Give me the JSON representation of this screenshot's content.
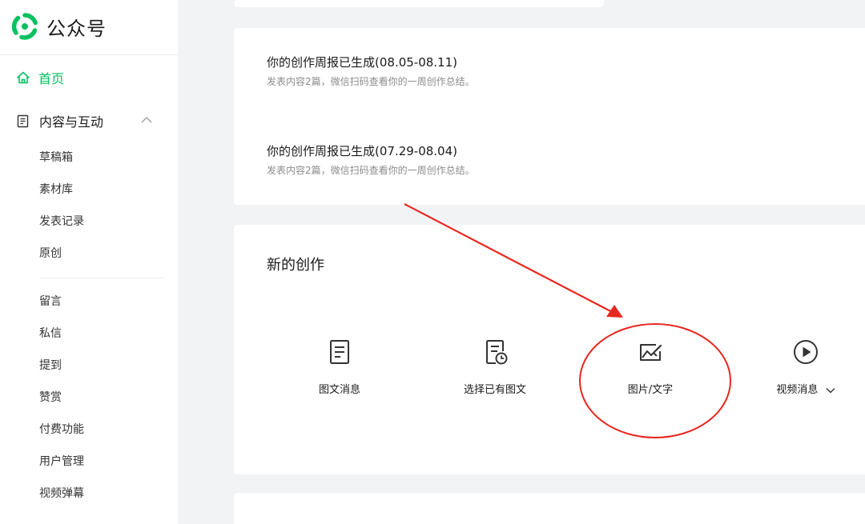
{
  "brand": {
    "name": "公众号",
    "accent": "#07c160"
  },
  "sidebar": {
    "home_label": "首页",
    "group_label": "内容与互动",
    "items": [
      {
        "label": "草稿箱"
      },
      {
        "label": "素材库"
      },
      {
        "label": "发表记录"
      },
      {
        "label": "原创"
      },
      {
        "label": "留言"
      },
      {
        "label": "私信"
      },
      {
        "label": "提到"
      },
      {
        "label": "赞赏"
      },
      {
        "label": "付费功能"
      },
      {
        "label": "用户管理"
      },
      {
        "label": "视频弹幕"
      }
    ]
  },
  "reports": [
    {
      "title": "你的创作周报已生成(08.05-08.11)",
      "desc": "发表内容2篇，微信扫码查看你的一周创作总结。"
    },
    {
      "title": "你的创作周报已生成(07.29-08.04)",
      "desc": "发表内容2篇，微信扫码查看你的一周创作总结。"
    }
  ],
  "create": {
    "title": "新的创作",
    "items": [
      {
        "label": "图文消息",
        "icon": "document-icon"
      },
      {
        "label": "选择已有图文",
        "icon": "document-clock-icon"
      },
      {
        "label": "图片/文字",
        "icon": "image-edit-icon"
      },
      {
        "label": "视频消息",
        "icon": "play-circle-icon"
      }
    ]
  },
  "annotation": {
    "color": "#e8271f"
  }
}
